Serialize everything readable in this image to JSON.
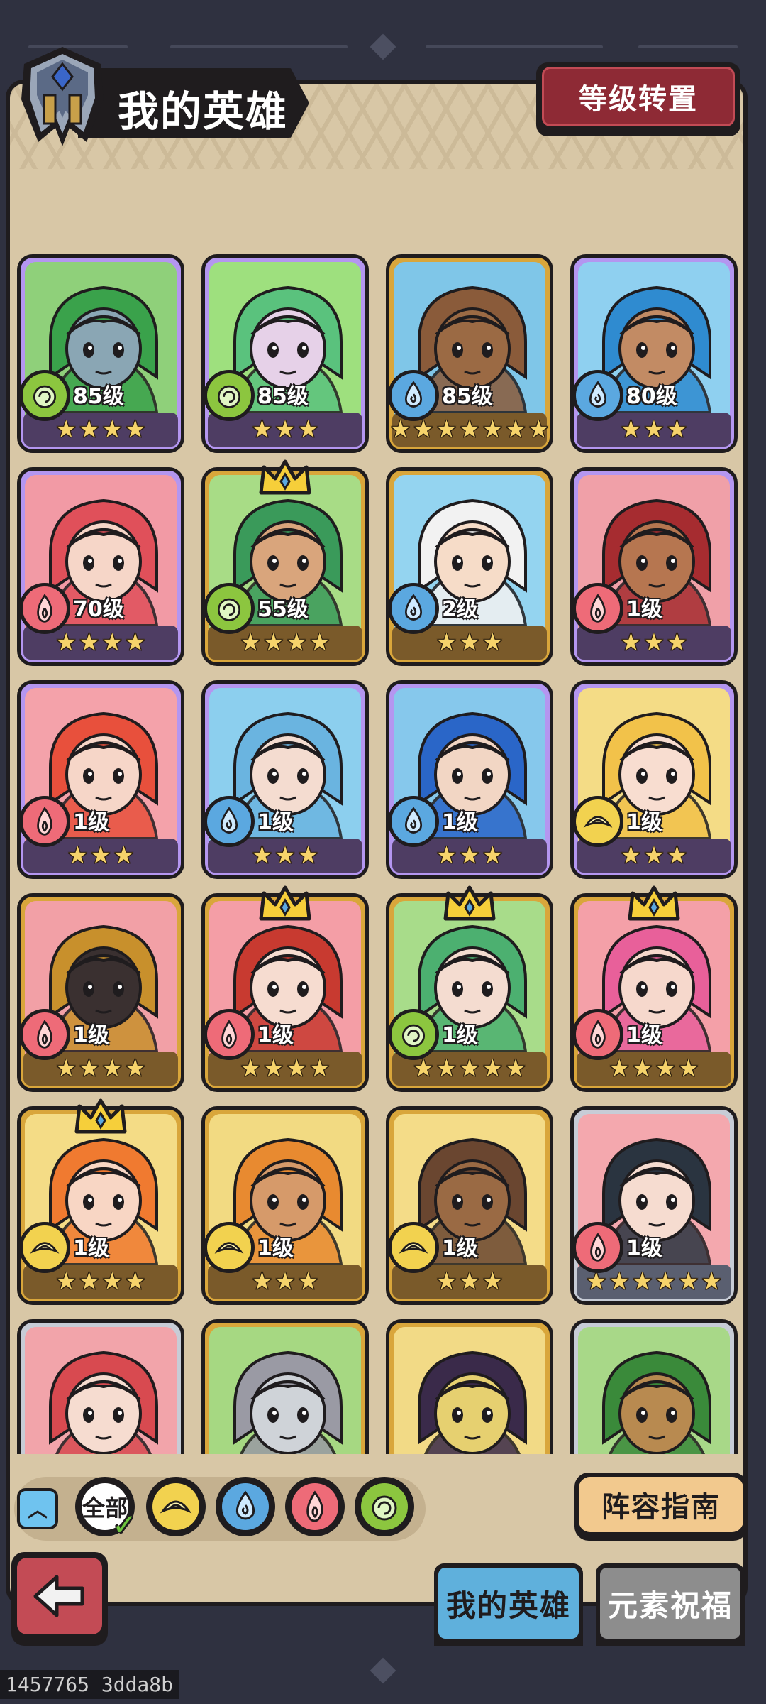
{
  "header": {
    "title": "我的英雄",
    "reset_label": "等级转置"
  },
  "heroes": [
    {
      "level": "85级",
      "element": "nature",
      "stars": 4,
      "frame": "purple",
      "bg": "#8fd07a",
      "hair": "#3aa24b",
      "skin": "#8aa6b4",
      "crown": false
    },
    {
      "level": "85级",
      "element": "nature",
      "stars": 3,
      "frame": "purple",
      "bg": "#9ee07e",
      "hair": "#5ac27d",
      "skin": "#e6d1e8",
      "crown": false
    },
    {
      "level": "85级",
      "element": "water",
      "stars": 7,
      "frame": "gold",
      "bg": "#7fc6e8",
      "hair": "#8a5b3a",
      "skin": "#9b6a44",
      "crown": false
    },
    {
      "level": "80级",
      "element": "water",
      "stars": 3,
      "frame": "purple",
      "bg": "#8fd0f0",
      "hair": "#2f8bd0",
      "skin": "#c28b64",
      "crown": false
    },
    {
      "level": "70级",
      "element": "fire",
      "stars": 4,
      "frame": "purple",
      "bg": "#f29aa5",
      "hair": "#e0505a",
      "skin": "#f6d6c8",
      "crown": false
    },
    {
      "level": "55级",
      "element": "nature",
      "stars": 4,
      "frame": "gold",
      "bg": "#a8dc86",
      "hair": "#3a9a5a",
      "skin": "#d9a57c",
      "crown": true
    },
    {
      "level": "2级",
      "element": "water",
      "stars": 3,
      "frame": "gold",
      "bg": "#94d4f0",
      "hair": "#f2f2f2",
      "skin": "#f6dcc8",
      "crown": false
    },
    {
      "level": "1级",
      "element": "fire",
      "stars": 3,
      "frame": "purple",
      "bg": "#f0a0a8",
      "hair": "#a62c30",
      "skin": "#b67650",
      "crown": false
    },
    {
      "level": "1级",
      "element": "fire",
      "stars": 3,
      "frame": "purple",
      "bg": "#f4a2aa",
      "hair": "#e8503c",
      "skin": "#f6d6c8",
      "crown": false
    },
    {
      "level": "1级",
      "element": "water",
      "stars": 3,
      "frame": "purple",
      "bg": "#8ccfee",
      "hair": "#6ab4e0",
      "skin": "#f4dcd0",
      "crown": false
    },
    {
      "level": "1级",
      "element": "water",
      "stars": 3,
      "frame": "purple",
      "bg": "#86c8ec",
      "hair": "#2a66c8",
      "skin": "#f2d6c4",
      "crown": false
    },
    {
      "level": "1级",
      "element": "light",
      "stars": 3,
      "frame": "purple",
      "bg": "#f4dc86",
      "hair": "#f2c24a",
      "skin": "#f8ddd0",
      "crown": false
    },
    {
      "level": "1级",
      "element": "fire",
      "stars": 4,
      "frame": "gold",
      "bg": "#f2a0a6",
      "hair": "#c8902c",
      "skin": "#3a3030",
      "crown": false
    },
    {
      "level": "1级",
      "element": "fire",
      "stars": 4,
      "frame": "gold",
      "bg": "#f49ea6",
      "hair": "#c83a30",
      "skin": "#f6dcd0",
      "crown": true
    },
    {
      "level": "1级",
      "element": "nature",
      "stars": 5,
      "frame": "gold",
      "bg": "#a8dc8a",
      "hair": "#4cb070",
      "skin": "#f4dcd0",
      "crown": true
    },
    {
      "level": "1级",
      "element": "fire",
      "stars": 4,
      "frame": "gold",
      "bg": "#f4a0a8",
      "hair": "#e8609a",
      "skin": "#f6d8cc",
      "crown": true
    },
    {
      "level": "1级",
      "element": "light",
      "stars": 4,
      "frame": "gold",
      "bg": "#f4dc86",
      "hair": "#f07a30",
      "skin": "#f8d6c4",
      "crown": true
    },
    {
      "level": "1级",
      "element": "light",
      "stars": 3,
      "frame": "gold",
      "bg": "#f2da82",
      "hair": "#e88a30",
      "skin": "#d69a6a",
      "crown": false
    },
    {
      "level": "1级",
      "element": "light",
      "stars": 3,
      "frame": "gold",
      "bg": "#f4dc88",
      "hair": "#6a4630",
      "skin": "#9a6a44",
      "crown": false
    },
    {
      "level": "1级",
      "element": "fire",
      "stars": 6,
      "frame": "silver",
      "bg": "#f4a8ae",
      "hair": "#2a3440",
      "skin": "#f6dcd0",
      "crown": false
    },
    {
      "level": "",
      "element": "",
      "stars": 0,
      "frame": "silver",
      "bg": "#f2a4aa",
      "hair": "#d84a50",
      "skin": "#f6dcd0",
      "crown": false
    },
    {
      "level": "",
      "element": "",
      "stars": 0,
      "frame": "gold",
      "bg": "#a6d882",
      "hair": "#9a9aa4",
      "skin": "#cfd3d8",
      "crown": false
    },
    {
      "level": "",
      "element": "",
      "stars": 0,
      "frame": "gold",
      "bg": "#f2da86",
      "hair": "#3a2a4a",
      "skin": "#e6d070",
      "crown": false
    },
    {
      "level": "",
      "element": "",
      "stars": 0,
      "frame": "silver",
      "bg": "#a8d888",
      "hair": "#3a8a3a",
      "skin": "#b88a50",
      "crown": false
    }
  ],
  "filters": {
    "all_label": "全部",
    "items": [
      "light",
      "water",
      "fire",
      "nature"
    ]
  },
  "guide_label": "阵容指南",
  "tabs": {
    "my_heroes": "我的英雄",
    "element_blessing": "元素祝福"
  },
  "build_id": "1457765 3dda8b",
  "colors": {
    "nature": "#8cc63f",
    "water": "#5ba8e0",
    "fire": "#ee6b78",
    "light": "#f2d24f"
  }
}
